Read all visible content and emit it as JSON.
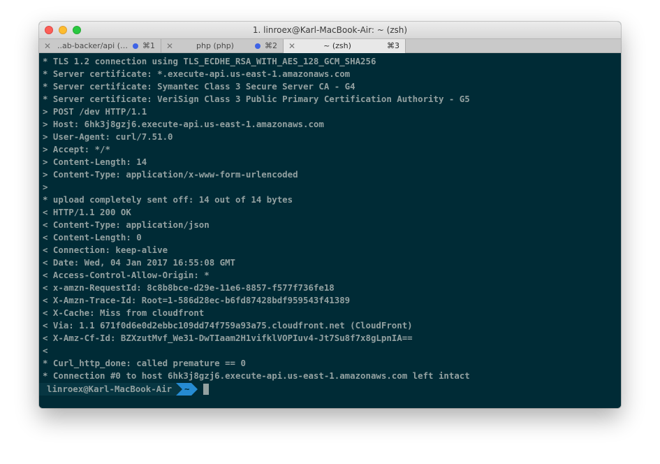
{
  "window": {
    "title": "1. linroex@Karl-MacBook-Air: ~ (zsh)",
    "colors": {
      "background": "#002b36",
      "text": "#93a1a1",
      "accent": "#268bd2"
    }
  },
  "tabs": [
    {
      "label": "..ab-backer/api (z...",
      "shortcut": "⌘1",
      "has_activity": true,
      "active": false
    },
    {
      "label": "php (php)",
      "shortcut": "⌘2",
      "has_activity": true,
      "active": false
    },
    {
      "label": "~ (zsh)",
      "shortcut": "⌘3",
      "has_activity": false,
      "active": true
    }
  ],
  "terminal": {
    "lines": [
      "* TLS 1.2 connection using TLS_ECDHE_RSA_WITH_AES_128_GCM_SHA256",
      "* Server certificate: *.execute-api.us-east-1.amazonaws.com",
      "* Server certificate: Symantec Class 3 Secure Server CA - G4",
      "* Server certificate: VeriSign Class 3 Public Primary Certification Authority - G5",
      "> POST /dev HTTP/1.1",
      "> Host: 6hk3j8gzj6.execute-api.us-east-1.amazonaws.com",
      "> User-Agent: curl/7.51.0",
      "> Accept: */*",
      "> Content-Length: 14",
      "> Content-Type: application/x-www-form-urlencoded",
      ">",
      "* upload completely sent off: 14 out of 14 bytes",
      "< HTTP/1.1 200 OK",
      "< Content-Type: application/json",
      "< Content-Length: 0",
      "< Connection: keep-alive",
      "< Date: Wed, 04 Jan 2017 16:55:08 GMT",
      "< Access-Control-Allow-Origin: *",
      "< x-amzn-RequestId: 8c8b8bce-d29e-11e6-8857-f577f736fe18",
      "< X-Amzn-Trace-Id: Root=1-586d28ec-b6fd87428bdf959543f41389",
      "< X-Cache: Miss from cloudfront",
      "< Via: 1.1 671f0d6e0d2ebbc109dd74f759a93a75.cloudfront.net (CloudFront)",
      "< X-Amz-Cf-Id: BZXzutMvf_We31-DwTIaam2H1vifklVOPIuv4-Jt7Su8f7x8gLpnIA==",
      "<",
      "* Curl_http_done: called premature == 0",
      "* Connection #0 to host 6hk3j8gzj6.execute-api.us-east-1.amazonaws.com left intact"
    ],
    "prompt": {
      "user_host": "linroex@Karl-MacBook-Air",
      "directory": "~"
    }
  }
}
